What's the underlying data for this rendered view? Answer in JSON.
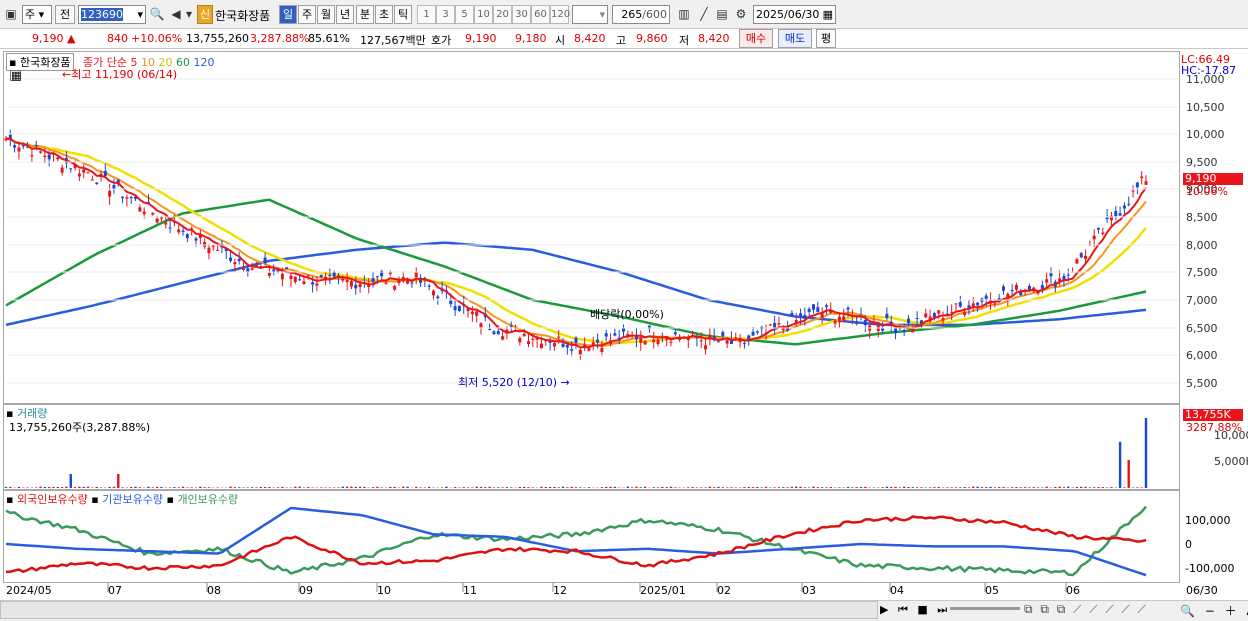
{
  "toolbar": {
    "market_type": "주",
    "prev_label": "전",
    "code": "123690",
    "credit_badge": "신",
    "stock_name": "한국화장품",
    "periods": [
      "일",
      "주",
      "월",
      "년",
      "분",
      "초",
      "틱"
    ],
    "active_period": "일",
    "intervals": [
      "1",
      "3",
      "5",
      "10",
      "20",
      "30",
      "60",
      "120"
    ],
    "count_value": "265",
    "count_total": "/600",
    "date": "2025/06/30"
  },
  "quote": {
    "price": "9,190",
    "change_arrow": "▲",
    "change": "840",
    "change_pct": "+10.06%",
    "volume": "13,755,260",
    "volume_pct": "3,287.88%",
    "turnover": "85.61%",
    "amount": "127,567백만",
    "ask_label": "호가",
    "ask1": "9,190",
    "ask2": "9,180",
    "open_label": "시",
    "open": "8,420",
    "high_label": "고",
    "high": "9,860",
    "low_label": "저",
    "low": "8,420",
    "buy_label": "매수",
    "sell_label": "매도",
    "eval_label": "평"
  },
  "price_panel": {
    "stock_tag": "한국화장품",
    "ma_label": "종가 단순",
    "ma_periods": [
      "5",
      "10",
      "20",
      "60",
      "120"
    ],
    "ma_colors": [
      "#e8161c",
      "#f7941d",
      "#f0e000",
      "#1a9a3a",
      "#2a5ce0"
    ],
    "high_note": "최고 11,190 (06/14)",
    "low_note": "최저 5,520 (12/10)",
    "dividend_note": "배당락(0,00%)",
    "lc": "LC:66.49",
    "hc": "HC:-17.87",
    "y_ticks": [
      "11,000",
      "10,500",
      "10,000",
      "9,500",
      "9,000",
      "8,500",
      "8,000",
      "7,500",
      "7,000",
      "6,500",
      "6,000",
      "5,500"
    ],
    "current_price_tag": "9,190",
    "current_pct_tag": "10.06%"
  },
  "volume_panel": {
    "title": "거래량",
    "value": "13,755,260주(3,287.88%)",
    "y_ticks": [
      "10,000K",
      "5,000K"
    ],
    "tag_value": "13,755K",
    "tag_pct": "3287.88%"
  },
  "holdings_panel": {
    "series": [
      "외국인보유수량",
      "기관보유수량",
      "개인보유수량"
    ],
    "series_colors": [
      "#dd1111",
      "#2a5ce0",
      "#3a9a5a"
    ],
    "y_ticks": [
      "100,000",
      "0",
      "-100,000"
    ]
  },
  "x_axis": {
    "labels": [
      "2024/05",
      "07",
      "08",
      "09",
      "10",
      "11",
      "12",
      "2025/01",
      "02",
      "03",
      "04",
      "05",
      "06"
    ],
    "end_label": "06/30"
  },
  "chart_data": {
    "type": "candlestick",
    "x_range": [
      "2024/05",
      "2025/06/30"
    ],
    "price_range": [
      5200,
      11400
    ],
    "price_series_sampled": [
      {
        "x": "2024/05",
        "close": 9900
      },
      {
        "x": "2024/06",
        "close": 9300
      },
      {
        "x": "2024/07",
        "close": 8400
      },
      {
        "x": "2024/08",
        "close": 7600
      },
      {
        "x": "2024/09",
        "close": 7300
      },
      {
        "x": "2024/10",
        "close": 7400
      },
      {
        "x": "2024/11",
        "close": 6500
      },
      {
        "x": "2024/12",
        "close": 6200
      },
      {
        "x": "2025/01",
        "close": 6400
      },
      {
        "x": "2025/02",
        "close": 6200
      },
      {
        "x": "2025/03",
        "close": 6800
      },
      {
        "x": "2025/04",
        "close": 6500
      },
      {
        "x": "2025/05",
        "close": 7000
      },
      {
        "x": "2025/06",
        "close": 7400
      },
      {
        "x": "2025/06/30",
        "close": 9190
      }
    ],
    "ma120_sampled": [
      6550,
      6900,
      7300,
      7700,
      7900,
      8030,
      7900,
      7500,
      7000,
      6700,
      6550,
      6550,
      6650,
      6820
    ],
    "ma60_sampled": [
      6900,
      7800,
      8550,
      8800,
      8100,
      7600,
      7000,
      6700,
      6350,
      6200,
      6400,
      6550,
      6800,
      7150
    ]
  }
}
